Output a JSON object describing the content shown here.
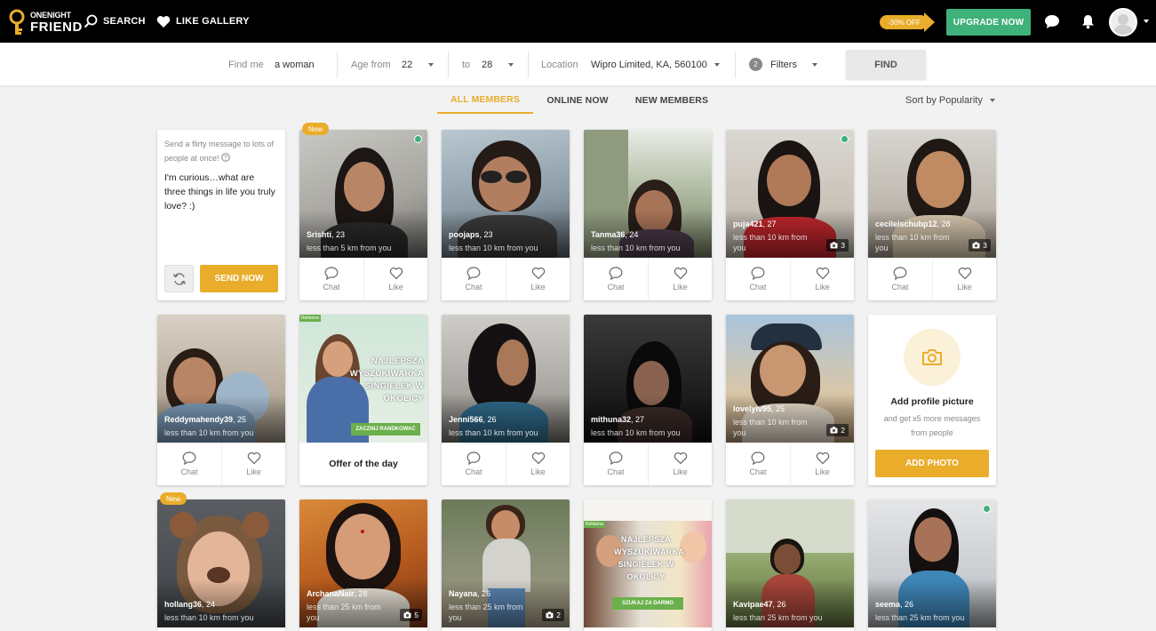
{
  "brand": {
    "line1": "ONENIGHT",
    "line2": "FRIEND"
  },
  "nav": {
    "search": "SEARCH",
    "like_gallery": "LIKE GALLERY"
  },
  "promo": {
    "discount": "-30% OFF",
    "upgrade": "UPGRADE NOW"
  },
  "filters": {
    "find_me_label": "Find me",
    "find_me_value": "a woman",
    "age_from_label": "Age from",
    "age_from_value": "22",
    "age_to_label": "to",
    "age_to_value": "28",
    "location_label": "Location",
    "location_value": "Wipro Limited, KA, 560100",
    "filters_count": "2",
    "filters_label": "Filters",
    "find_button": "FIND"
  },
  "tabs": {
    "all": "ALL MEMBERS",
    "online": "ONLINE NOW",
    "new": "NEW MEMBERS"
  },
  "sort": "Sort by Popularity",
  "message_card": {
    "hint": "Send a flirty message to lots of people at once!",
    "text": "I'm curious…what are three things in life you truly love? :)",
    "send": "SEND NOW"
  },
  "actions": {
    "chat": "Chat",
    "like": "Like"
  },
  "badge_new": "New",
  "members": [
    {
      "name": "Srishti",
      "age": ", 23",
      "distance": "less than 5 km from you"
    },
    {
      "name": "poojaps",
      "age": ", 23",
      "distance": "less than 10 km from you"
    },
    {
      "name": "Tanma36",
      "age": ", 24",
      "distance": "less than 10 km from you"
    },
    {
      "name": "puja421",
      "age": ", 27",
      "distance": "less than 10 km from you",
      "photos": "3"
    },
    {
      "name": "cecilelschubp12",
      "age": ", 28",
      "distance": "less than 10 km from you",
      "photos": "3"
    },
    {
      "name": "Reddymahendy39",
      "age": ", 25",
      "distance": "less than 10 km from you"
    },
    {
      "name": "Jenni566",
      "age": ", 26",
      "distance": "less than 10 km from you"
    },
    {
      "name": "mithuna32",
      "age": ", 27",
      "distance": "less than 10 km from you"
    },
    {
      "name": "lovelyiv95",
      "age": ", 25",
      "distance": "less than 10 km from you",
      "photos": "2"
    },
    {
      "name": "hollang36",
      "age": ", 24",
      "distance": "less than 10 km from you"
    },
    {
      "name": "ArchanaNair",
      "age": ", 28",
      "distance": "less than 25 km from you",
      "photos": "5"
    },
    {
      "name": "Nayana",
      "age": ", 26",
      "distance": "less than 25 km from you",
      "photos": "2"
    },
    {
      "name": "Kavipae47",
      "age": ", 26",
      "distance": "less than 25 km from you"
    },
    {
      "name": "seema",
      "age": ", 26",
      "distance": "less than 25 km from you"
    }
  ],
  "offer": {
    "label": "Offer of the day",
    "tag": "Reklama",
    "ad1_text": "NAJLEPSZA WYSZUKIWARKA SINGIELEK W OKOLICY",
    "ad1_btn": "ZACZNIJ RANDKOWAĆ",
    "ad2_text": "NAJLEPSZA WYSZUKIWARKA SINGIELEK W OKOLICY",
    "ad2_btn": "SZUKAJ ZA DARMO"
  },
  "add_photo": {
    "title": "Add profile picture",
    "subtitle": "and get x5 more messages from people",
    "button": "ADD PHOTO"
  },
  "colors": {
    "accent": "#e9ad2b",
    "green": "#3fb17b",
    "topbar": "#000000"
  }
}
